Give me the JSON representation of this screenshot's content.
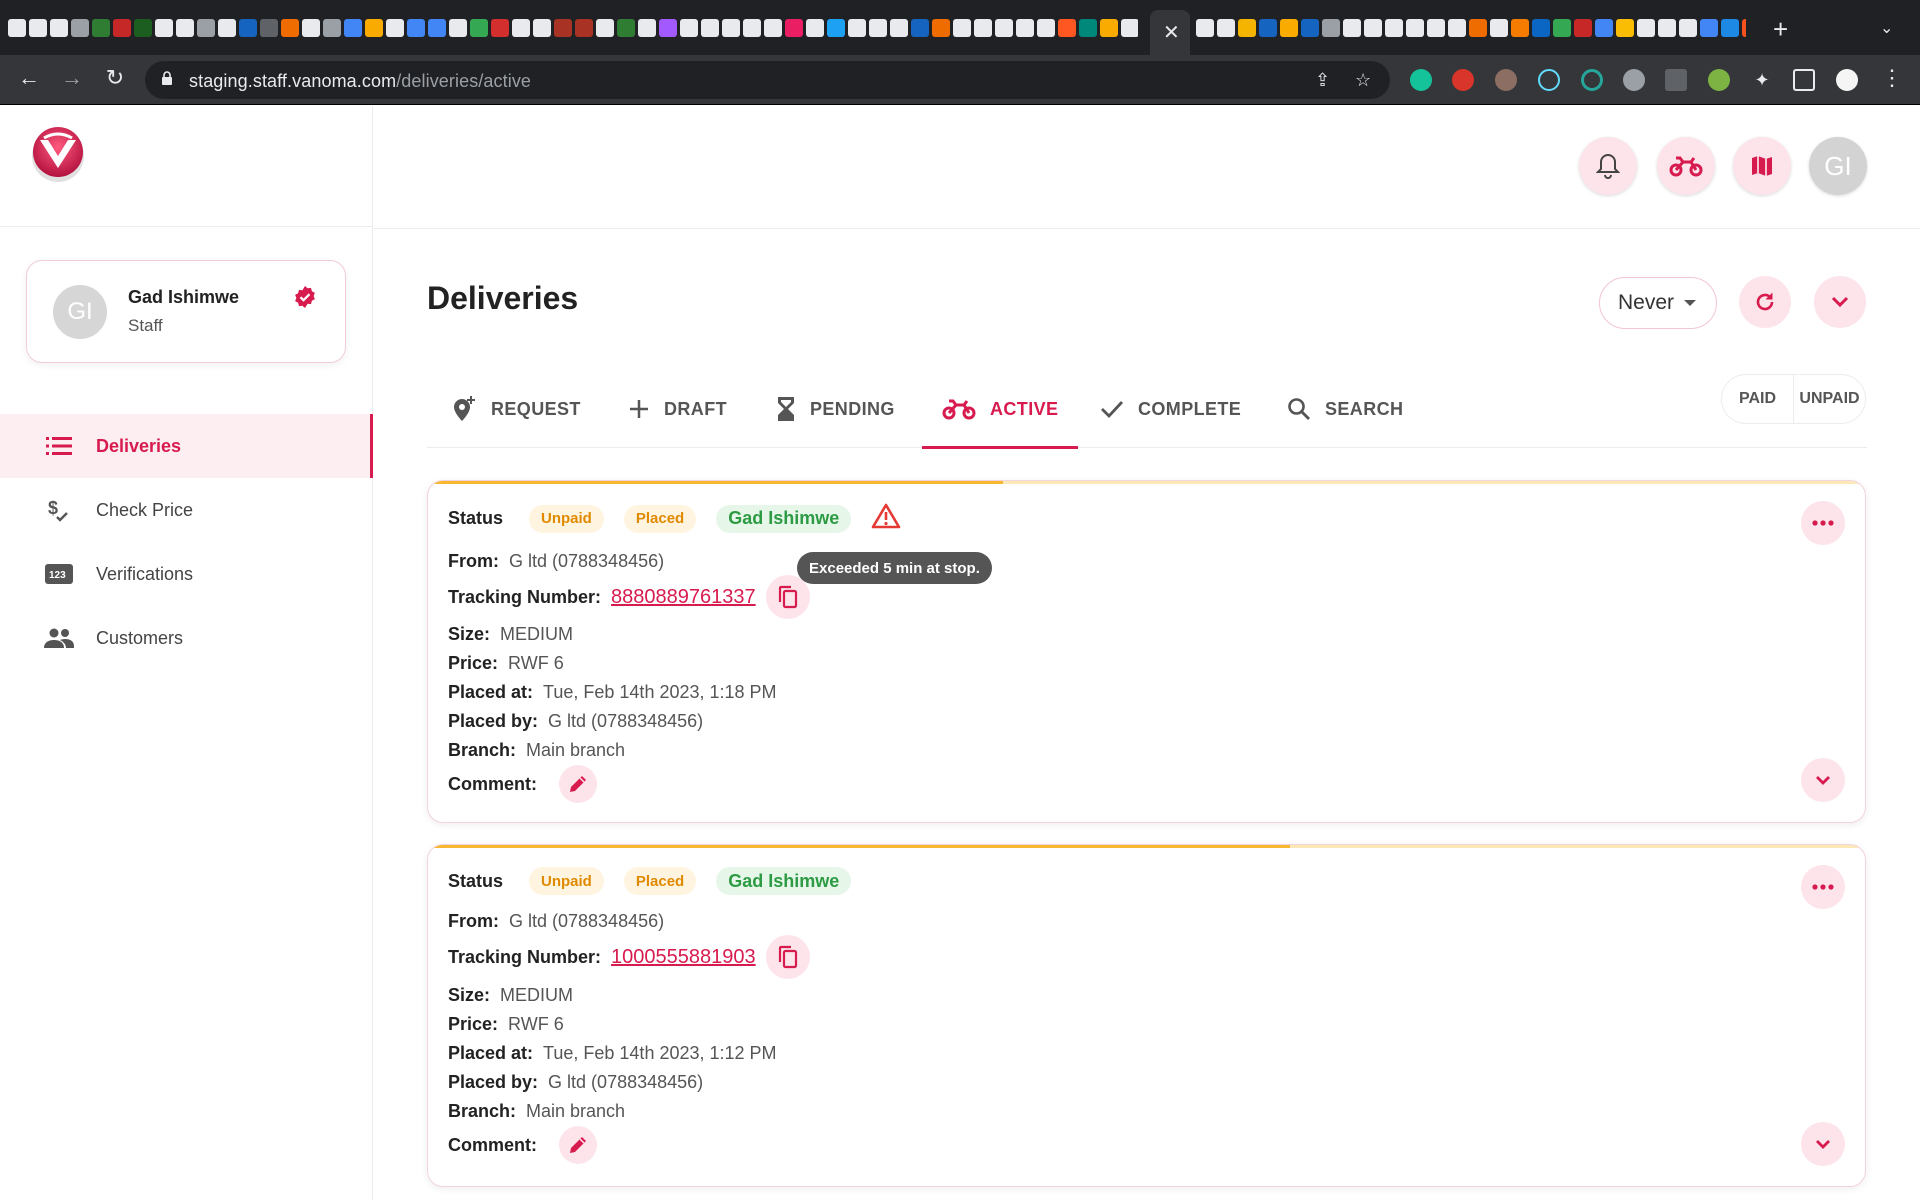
{
  "browser": {
    "url_host": "staging.staff.vanoma.com",
    "url_path": "/deliveries/active"
  },
  "profile": {
    "initials": "GI",
    "name": "Gad Ishimwe",
    "role": "Staff"
  },
  "sidebar": {
    "items": [
      {
        "label": "Deliveries",
        "icon": "list-icon"
      },
      {
        "label": "Check Price",
        "icon": "price-check-icon"
      },
      {
        "label": "Verifications",
        "icon": "123-icon"
      },
      {
        "label": "Customers",
        "icon": "people-icon"
      }
    ]
  },
  "header": {
    "avatar_initials": "GI"
  },
  "page": {
    "title": "Deliveries",
    "refresh_select": "Never"
  },
  "tabs": [
    {
      "label": "REQUEST"
    },
    {
      "label": "DRAFT"
    },
    {
      "label": "PENDING"
    },
    {
      "label": "ACTIVE"
    },
    {
      "label": "COMPLETE"
    },
    {
      "label": "SEARCH"
    }
  ],
  "payment_filter": {
    "paid": "PAID",
    "unpaid": "UNPAID"
  },
  "labels": {
    "status": "Status",
    "from": "From:",
    "tracking": "Tracking Number:",
    "size": "Size:",
    "price": "Price:",
    "placed_at": "Placed at:",
    "placed_by": "Placed by:",
    "branch": "Branch:",
    "comment": "Comment:"
  },
  "tooltip": "Exceeded 5 min at stop.",
  "deliveries": [
    {
      "payment": "Unpaid",
      "state": "Placed",
      "assignee": "Gad Ishimwe",
      "warning": true,
      "progress": 0.4,
      "from": "G ltd (0788348456)",
      "tracking": "8880889761337",
      "size": "MEDIUM",
      "price": "RWF 6",
      "placed_at": "Tue, Feb 14th 2023, 1:18 PM",
      "placed_by": "G ltd (0788348456)",
      "branch": "Main branch"
    },
    {
      "payment": "Unpaid",
      "state": "Placed",
      "assignee": "Gad Ishimwe",
      "warning": false,
      "progress": 0.6,
      "from": "G ltd (0788348456)",
      "tracking": "1000555881903",
      "size": "MEDIUM",
      "price": "RWF 6",
      "placed_at": "Tue, Feb 14th 2023, 1:12 PM",
      "placed_by": "G ltd (0788348456)",
      "branch": "Main branch"
    }
  ],
  "colors": {
    "accent": "#d81b4f",
    "accent_soft": "#fce4ea",
    "warning": "#f7b731"
  }
}
